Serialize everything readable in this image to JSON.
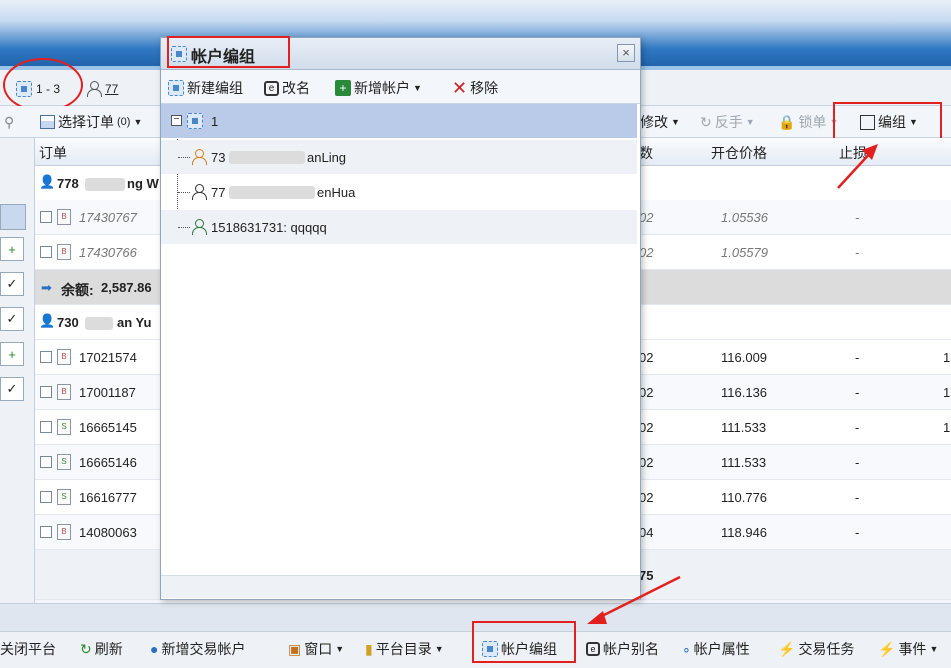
{
  "account_bar": {
    "tab_range": "1 - 3",
    "tab2_label": "77"
  },
  "toolbar": {
    "select_orders": "选择订单",
    "select_count": "(0)",
    "modify": "修改",
    "reverse": "反手",
    "lock": "锁单",
    "group": "编组"
  },
  "table": {
    "headers": {
      "order": "订单",
      "count": "数",
      "open_price": "开仓价格",
      "stop_loss": "止损"
    },
    "group1": {
      "name": "778",
      "suffix": "ng W"
    },
    "group1_rows": [
      {
        "order": "17430767",
        "count": "02",
        "open_price": "1.05536",
        "stop_loss": "-",
        "kind": "B"
      },
      {
        "order": "17430766",
        "count": "02",
        "open_price": "1.05579",
        "stop_loss": "-",
        "kind": "B"
      }
    ],
    "balance": {
      "label": "余额:",
      "value": "2,587.86"
    },
    "group2": {
      "name": "730",
      "suffix": "an Yu"
    },
    "group2_rows": [
      {
        "order": "17021574",
        "count": "02",
        "open_price": "116.009",
        "stop_loss": "-",
        "extra": "1",
        "kind": "B"
      },
      {
        "order": "17001187",
        "count": "02",
        "open_price": "116.136",
        "stop_loss": "-",
        "extra": "1",
        "kind": "B"
      },
      {
        "order": "16665145",
        "count": "02",
        "open_price": "111.533",
        "stop_loss": "-",
        "extra": "1",
        "kind": "S"
      },
      {
        "order": "16665146",
        "count": "02",
        "open_price": "111.533",
        "stop_loss": "-",
        "extra": "",
        "kind": "S"
      },
      {
        "order": "16616777",
        "count": "02",
        "open_price": "110.776",
        "stop_loss": "-",
        "extra": "",
        "kind": "S"
      },
      {
        "order": "14080063",
        "count": "04",
        "open_price": "118.946",
        "stop_loss": "-",
        "extra": "",
        "kind": "B"
      }
    ],
    "footer_value": "75"
  },
  "dialog": {
    "title": "帐户编组",
    "close_glyph": "×",
    "toolbar": {
      "new_group": "新建编组",
      "rename": "改名",
      "add_account": "新增帐户",
      "remove": "移除"
    },
    "tree": {
      "root": "1",
      "children": [
        {
          "prefix": "73",
          "suffix": "anLing"
        },
        {
          "prefix": "77",
          "suffix": "enHua"
        },
        {
          "prefix": "",
          "suffix": "1518631731: qqqqq"
        }
      ]
    }
  },
  "bottom_bar": {
    "close_platform": "关闭平台",
    "refresh": "刷新",
    "add_trade_account": "新增交易帐户",
    "window": "窗口",
    "platform_dir": "平台目录",
    "account_group": "帐户编组",
    "account_alias": "帐户别名",
    "account_props": "帐户属性",
    "trade_tasks": "交易任务",
    "events": "事件"
  },
  "colors": {
    "accent": "#2f78c2",
    "annotation": "#e32020",
    "selection": "#b9cbe8"
  },
  "icons": [
    "group-icon",
    "user-icon",
    "edit-icon",
    "add-icon",
    "remove-icon",
    "refresh-icon",
    "window-icon",
    "folder-icon",
    "alias-icon",
    "props-icon",
    "task-icon",
    "event-icon",
    "lock-icon",
    "reverse-icon",
    "search-icon"
  ]
}
